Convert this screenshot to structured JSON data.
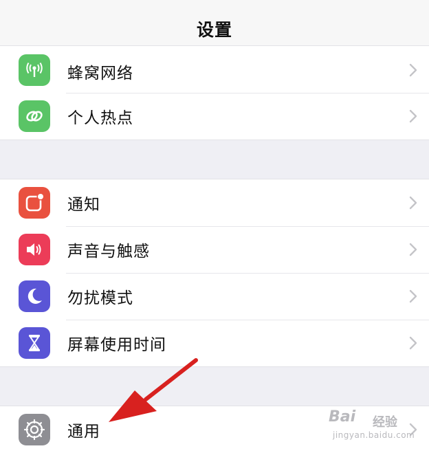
{
  "navbar": {
    "title": "设置"
  },
  "groups": {
    "network": {
      "items": [
        {
          "label": "蜂窝网络",
          "icon": "antenna-icon",
          "color": "#5ac466"
        },
        {
          "label": "个人热点",
          "icon": "hotspot-chain-icon",
          "color": "#5ac466"
        }
      ]
    },
    "alerts": {
      "items": [
        {
          "label": "通知",
          "icon": "notification-badge-icon",
          "color": "#e9513f"
        },
        {
          "label": "声音与触感",
          "icon": "speaker-icon",
          "color": "#ec3c58"
        },
        {
          "label": "勿扰模式",
          "icon": "moon-icon",
          "color": "#5a55d6"
        },
        {
          "label": "屏幕使用时间",
          "icon": "hourglass-icon",
          "color": "#5a55d6"
        }
      ]
    },
    "general": {
      "items": [
        {
          "label": "通用",
          "icon": "gear-icon",
          "color": "#8e8e93"
        }
      ]
    }
  },
  "annotation": {
    "arrow_color": "#d8211f"
  },
  "watermark": {
    "brand": "Bai",
    "sub": "经验",
    "url": "jingyan.baidu.com"
  }
}
